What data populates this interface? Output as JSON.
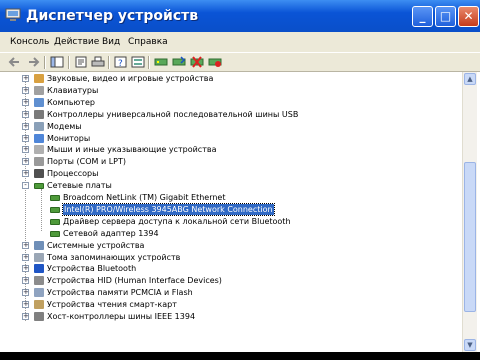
{
  "window": {
    "title": "Диспетчер устройств"
  },
  "menu": [
    "Консоль",
    "Действие",
    "Вид",
    "Справка"
  ],
  "toolbar": {
    "icons": [
      "back-icon",
      "forward-icon",
      "show-hide-tree-icon",
      "properties-icon",
      "print-icon",
      "help-icon",
      "view-icon",
      "scan-hardware-icon",
      "update-driver-icon",
      "uninstall-icon",
      "disable-icon"
    ]
  },
  "tree": {
    "items": [
      {
        "label": "Звуковые, видео и игровые устройства",
        "level": 1,
        "expander": "+",
        "icon": "sound-icon"
      },
      {
        "label": "Клавиатуры",
        "level": 1,
        "expander": "+",
        "icon": "keyboard-icon"
      },
      {
        "label": "Компьютер",
        "level": 1,
        "expander": "+",
        "icon": "computer-icon"
      },
      {
        "label": "Контроллеры универсальной последовательной шины USB",
        "level": 1,
        "expander": "+",
        "icon": "usb-icon"
      },
      {
        "label": "Модемы",
        "level": 1,
        "expander": "+",
        "icon": "modem-icon"
      },
      {
        "label": "Мониторы",
        "level": 1,
        "expander": "+",
        "icon": "monitor-icon"
      },
      {
        "label": "Мыши и иные указывающие устройства",
        "level": 1,
        "expander": "+",
        "icon": "mouse-icon"
      },
      {
        "label": "Порты (COM и LPT)",
        "level": 1,
        "expander": "+",
        "icon": "port-icon"
      },
      {
        "label": "Процессоры",
        "level": 1,
        "expander": "+",
        "icon": "processor-icon"
      },
      {
        "label": "Сетевые платы",
        "level": 1,
        "expander": "-",
        "icon": "network-card-icon"
      },
      {
        "label": "Broadcom NetLink (TM) Gigabit Ethernet",
        "level": 2,
        "expander": "",
        "icon": "network-card-icon"
      },
      {
        "label": "Intel(R) PRO/Wireless 3945ABG Network Connection",
        "level": 2,
        "expander": "",
        "icon": "network-card-icon",
        "selected": true
      },
      {
        "label": "Драйвер сервера доступа к локальной сети Bluetooth",
        "level": 2,
        "expander": "",
        "icon": "network-card-icon"
      },
      {
        "label": "Сетевой адаптер 1394",
        "level": 2,
        "expander": "",
        "icon": "network-card-icon"
      },
      {
        "label": "Системные устройства",
        "level": 1,
        "expander": "+",
        "icon": "system-icon"
      },
      {
        "label": "Тома запоминающих устройств",
        "level": 1,
        "expander": "+",
        "icon": "volume-icon"
      },
      {
        "label": "Устройства Bluetooth",
        "level": 1,
        "expander": "+",
        "icon": "bluetooth-icon"
      },
      {
        "label": "Устройства HID (Human Interface Devices)",
        "level": 1,
        "expander": "+",
        "icon": "hid-icon"
      },
      {
        "label": "Устройства памяти PCMCIA и Flash",
        "level": 1,
        "expander": "+",
        "icon": "pcmcia-icon"
      },
      {
        "label": "Устройства чтения смарт-карт",
        "level": 1,
        "expander": "+",
        "icon": "smartcard-icon"
      },
      {
        "label": "Хост-контроллеры шины IEEE 1394",
        "level": 1,
        "expander": "+",
        "icon": "ieee1394-icon"
      }
    ]
  },
  "colors": {
    "titlebar": "#0a54d6",
    "selection": "#316ac5",
    "chrome": "#ece9d8"
  }
}
